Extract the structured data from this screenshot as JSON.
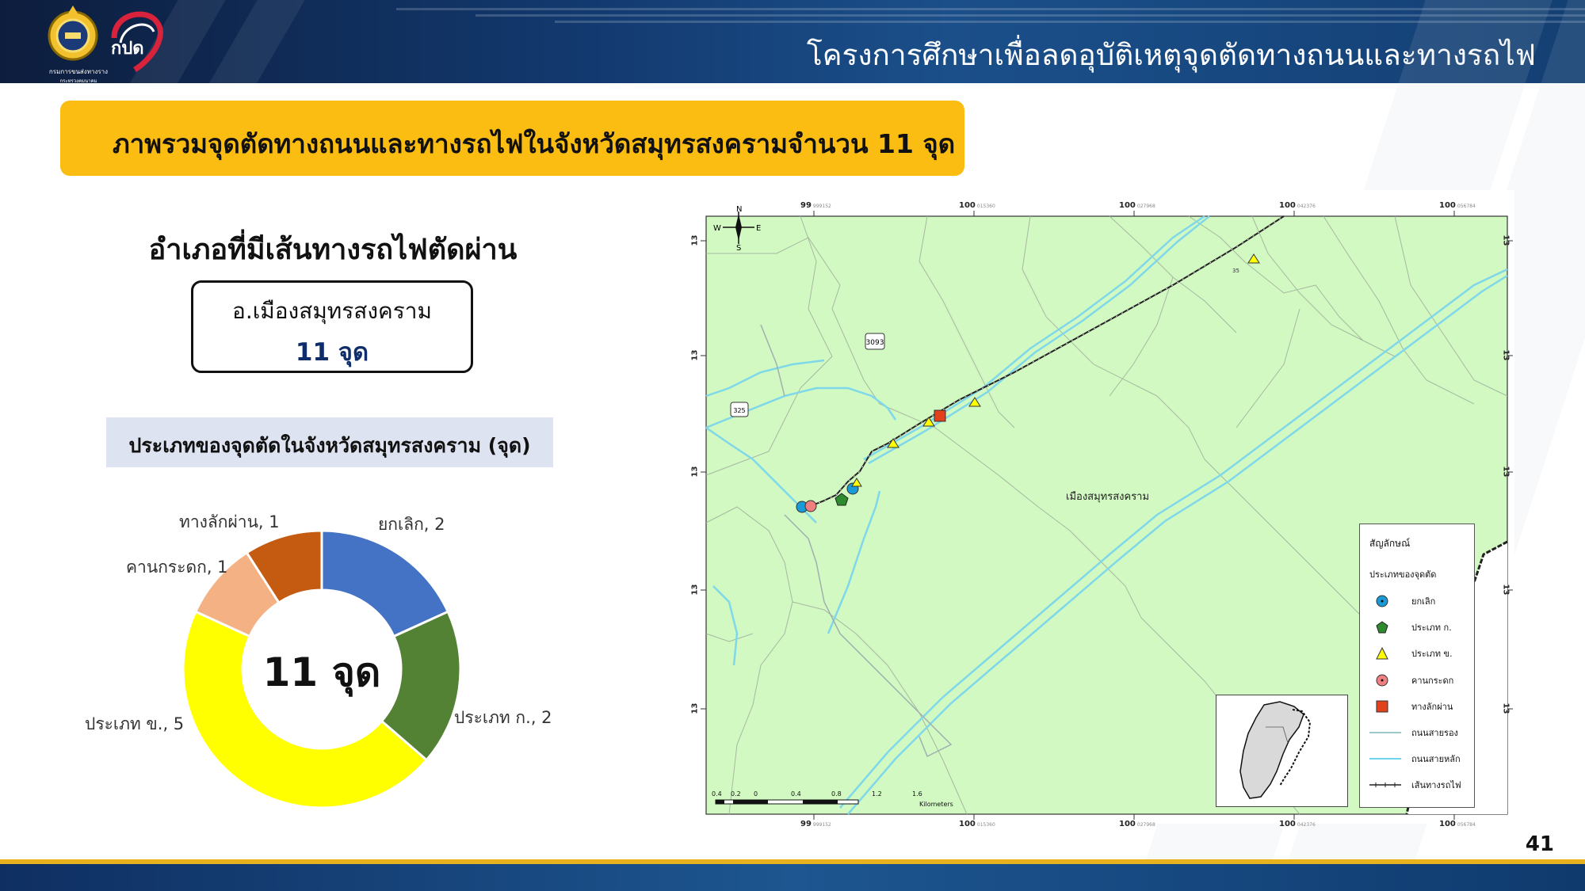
{
  "header": {
    "title": "โครงการศึกษาเพื่อลดอุบัติเหตุจุดตัดทางถนนและทางรถไฟ",
    "logo_text": "กรมการขนส่งทางราง",
    "logo_subtext": "กระทรวงคมนาคม",
    "logo2_text": "กปด"
  },
  "banner": {
    "title": "ภาพรวมจุดตัดทางถนนและทางรถไฟในจังหวัดสมุทรสงครามจำนวน 11 จุด"
  },
  "district": {
    "heading": "อำเภอที่มีเส้นทางรถไฟตัดผ่าน",
    "name": "อ.เมืองสมุทรสงคราม",
    "count": "11 จุด"
  },
  "chart_caption": "ประเภทของจุดตัดในจังหวัดสมุทรสงคราม (จุด)",
  "chart_data": {
    "type": "pie",
    "center_label": "11 จุด",
    "slices": [
      {
        "label": "ยกเลิก, 2",
        "name": "ยกเลิก",
        "value": 2,
        "color": "#4472c4"
      },
      {
        "label": "ประเภท ก., 2",
        "name": "ประเภท ก.",
        "value": 2,
        "color": "#548235"
      },
      {
        "label": "ประเภท ข., 5",
        "name": "ประเภท ข.",
        "value": 5,
        "color": "#ffff00"
      },
      {
        "label": "คานกระดก, 1",
        "name": "คานกระดก",
        "value": 1,
        "color": "#f4b183"
      },
      {
        "label": "ทางลักผ่าน, 1",
        "name": "ทางลักผ่าน",
        "value": 1,
        "color": "#c55a11"
      }
    ]
  },
  "map": {
    "district_label": "เมืองสมุทรสงคราม",
    "road_labels": [
      "3093",
      "325",
      "35"
    ],
    "top_coords": [
      {
        "main": "99",
        "sub": "999152"
      },
      {
        "main": "100",
        "sub": "015360"
      },
      {
        "main": "100",
        "sub": "027968"
      },
      {
        "main": "100",
        "sub": "042376"
      },
      {
        "main": "100",
        "sub": "056784"
      }
    ],
    "bottom_coords": [
      {
        "main": "99",
        "sub": "999152"
      },
      {
        "main": "100",
        "sub": "015360"
      },
      {
        "main": "100",
        "sub": "027968"
      },
      {
        "main": "100",
        "sub": "042376"
      },
      {
        "main": "100",
        "sub": "056784"
      }
    ],
    "side_coords": [
      "13",
      "13",
      "13",
      "13",
      "13"
    ],
    "compass": {
      "n": "N",
      "s": "S",
      "e": "E",
      "w": "W"
    },
    "scale_ticks": [
      "0.4",
      "0.2",
      "0",
      "0.4",
      "0.8",
      "1.2",
      "1.6"
    ],
    "scale_unit": "Kilometers",
    "legend": {
      "title": "สัญลักษณ์",
      "subtitle": "ประเภทของจุดตัด",
      "items": [
        {
          "label": "ยกเลิก",
          "symbol": "blue-octagon",
          "color": "#1a9ad6"
        },
        {
          "label": "ประเภท ก.",
          "symbol": "green-pentagon",
          "color": "#2e8b2e"
        },
        {
          "label": "ประเภท ข.",
          "symbol": "yellow-triangle",
          "color": "#ffff00"
        },
        {
          "label": "คานกระดก",
          "symbol": "pink-circle",
          "color": "#f08080"
        },
        {
          "label": "ทางลักผ่าน",
          "symbol": "red-square",
          "color": "#e2421b"
        },
        {
          "label": "ถนนสายรอง",
          "symbol": "minor-road-line",
          "color": "#9ec9c9"
        },
        {
          "label": "ถนนสายหลัก",
          "symbol": "major-road-line",
          "color": "#6fd5ea"
        },
        {
          "label": "เส้นทางรถไฟ",
          "symbol": "railway-line",
          "color": "#222222"
        }
      ]
    }
  },
  "page_number": "41"
}
